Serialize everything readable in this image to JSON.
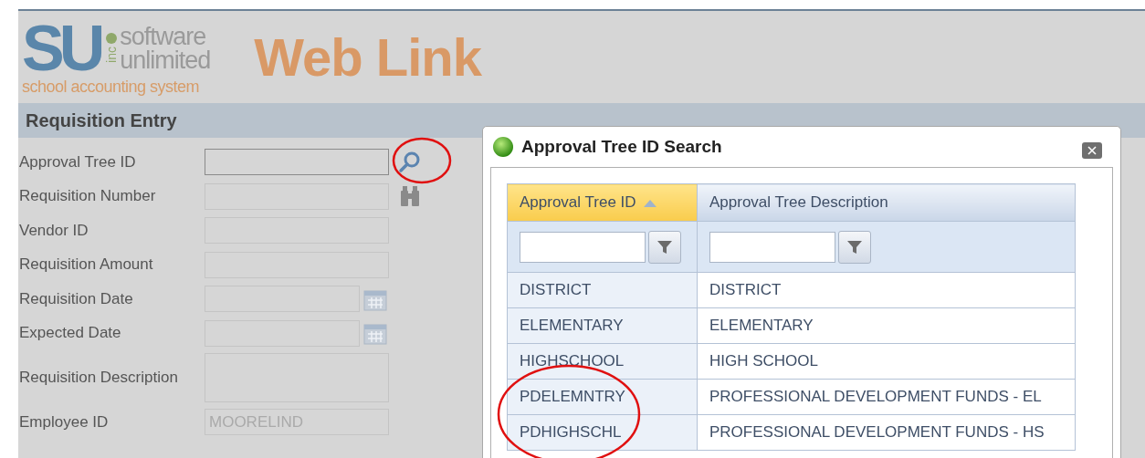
{
  "logo": {
    "mark": "SU",
    "inc": "inc",
    "line1": "software",
    "line2": "unlimited",
    "tagline": "school accounting system",
    "product": "Web Link"
  },
  "section": {
    "title": "Requisition Entry"
  },
  "form": [
    {
      "label": "Approval Tree ID",
      "kind": "search",
      "disabled": false
    },
    {
      "label": "Requisition Number",
      "kind": "find",
      "disabled": true
    },
    {
      "label": "Vendor ID",
      "kind": "text",
      "disabled": true
    },
    {
      "label": "Requisition Amount",
      "kind": "text",
      "disabled": true
    },
    {
      "label": "Requisition Date",
      "kind": "date",
      "disabled": true
    },
    {
      "label": "Expected Date",
      "kind": "date",
      "disabled": true
    },
    {
      "label": "Requisition Description",
      "kind": "textarea",
      "disabled": true
    },
    {
      "label": "Employee ID",
      "kind": "text",
      "disabled": true,
      "value": "MOORELIND"
    }
  ],
  "dialog": {
    "title": "Approval Tree ID Search",
    "columns": [
      {
        "label": "Approval Tree ID",
        "selected": true
      },
      {
        "label": "Approval Tree Description",
        "selected": false
      }
    ],
    "rows": [
      [
        "DISTRICT",
        "DISTRICT"
      ],
      [
        "ELEMENTARY",
        "ELEMENTARY"
      ],
      [
        "HIGHSCHOOL",
        "HIGH SCHOOL"
      ],
      [
        "PDELEMNTRY",
        "PROFESSIONAL DEVELOPMENT FUNDS - EL"
      ],
      [
        "PDHIGHSCHL",
        "PROFESSIONAL DEVELOPMENT FUNDS - HS"
      ]
    ]
  }
}
